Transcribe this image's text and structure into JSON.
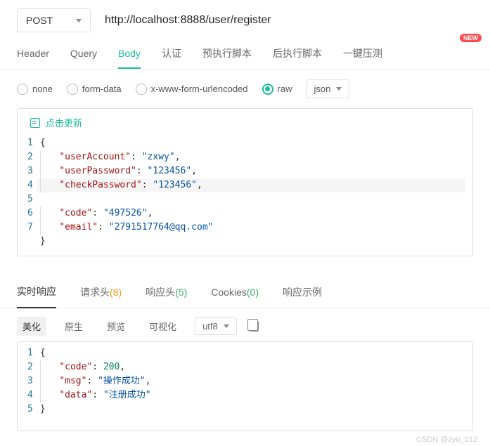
{
  "request": {
    "method": "POST",
    "url": "http://localhost:8888/user/register"
  },
  "tabs": {
    "items": [
      "Header",
      "Query",
      "Body",
      "认证",
      "预执行脚本",
      "后执行脚本",
      "一键压测"
    ],
    "active": 2,
    "new_badge": "NEW"
  },
  "body_types": {
    "items": [
      "none",
      "form-data",
      "x-www-form-urlencoded",
      "raw"
    ],
    "selected": 3,
    "format": "json"
  },
  "editor": {
    "update_label": "点击更新",
    "payload": {
      "userAccount": "zxwy",
      "userPassword": "123456",
      "checkPassword": "123456",
      "code": "497526",
      "email": "2791517764@qq.com"
    }
  },
  "response": {
    "tabs": [
      {
        "label": "实时响应",
        "count": null
      },
      {
        "label": "请求头",
        "count": 8,
        "color": "y"
      },
      {
        "label": "响应头",
        "count": 5,
        "color": "g"
      },
      {
        "label": "Cookies",
        "count": 0,
        "color": "g"
      },
      {
        "label": "响应示例",
        "count": null
      }
    ],
    "active": 0,
    "toolbar": {
      "items": [
        "美化",
        "原生",
        "预览",
        "可视化"
      ],
      "active": 0,
      "encoding": "utf8"
    },
    "body": {
      "code": 200,
      "msg": "操作成功",
      "data": "注册成功"
    }
  },
  "watermark": "CSDN @zyo_012"
}
